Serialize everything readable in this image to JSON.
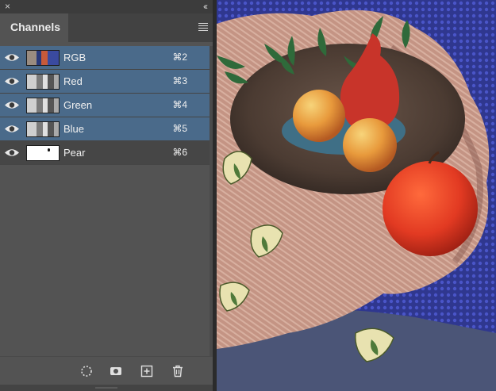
{
  "window": {
    "close_glyph": "×",
    "collapse_glyph": "‹‹"
  },
  "panel": {
    "tab_label": "Channels",
    "menu_icon": "hamburger-menu-icon"
  },
  "channels": [
    {
      "name": "RGB",
      "shortcut": "⌘2",
      "selected": true,
      "thumb": "rgb"
    },
    {
      "name": "Red",
      "shortcut": "⌘3",
      "selected": true,
      "thumb": "gray"
    },
    {
      "name": "Green",
      "shortcut": "⌘4",
      "selected": true,
      "thumb": "gray"
    },
    {
      "name": "Blue",
      "shortcut": "⌘5",
      "selected": true,
      "thumb": "gray"
    },
    {
      "name": "Pear",
      "shortcut": "⌘6",
      "selected": false,
      "thumb": "white"
    }
  ],
  "tools": [
    "load-selection-icon",
    "save-selection-icon",
    "new-channel-icon",
    "delete-channel-icon"
  ],
  "colors": {
    "selected_row": "#4a6a8a",
    "panel_bg": "#535353",
    "pear_mask": "#c8342a"
  }
}
